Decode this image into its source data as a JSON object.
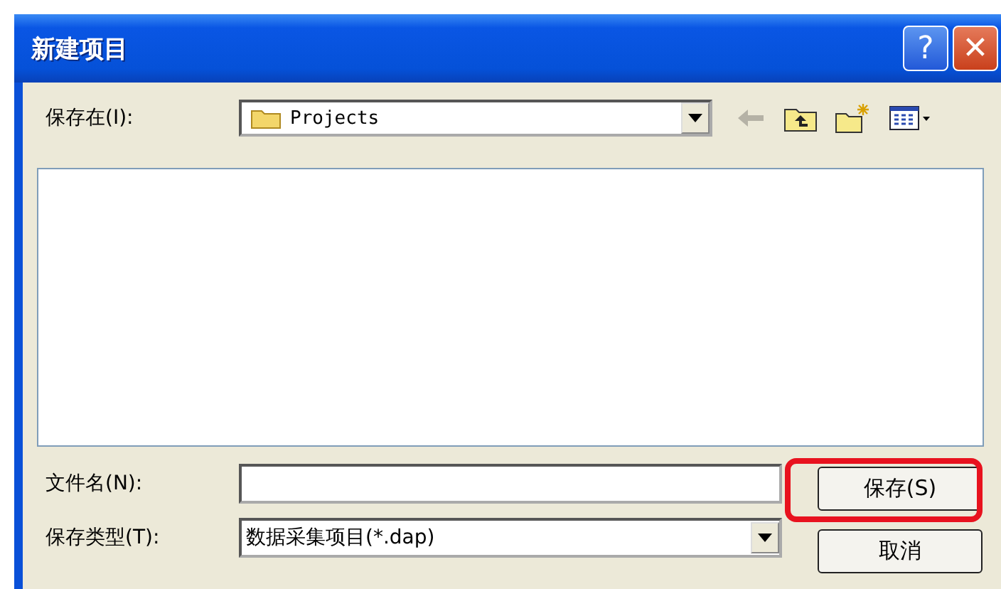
{
  "window": {
    "title": "新建项目",
    "buttons": [
      {
        "kind": "help",
        "label": "?"
      },
      {
        "kind": "close",
        "label": "✕"
      }
    ]
  },
  "save_in": {
    "label": "保存在(I):",
    "value": "Projects"
  },
  "toolbar": [
    {
      "kind": "back",
      "disabled": true
    },
    {
      "kind": "up",
      "disabled": false
    },
    {
      "kind": "new-folder",
      "disabled": false
    },
    {
      "kind": "view",
      "disabled": false
    }
  ],
  "file_name": {
    "label": "文件名(N):"
  },
  "file_type": {
    "label": "保存类型(T):",
    "value": "数据采集项目(*.dap)"
  },
  "buttons": [
    {
      "label": "保存(S)",
      "highlighted": true
    },
    {
      "label": "取消",
      "highlighted": false
    }
  ]
}
